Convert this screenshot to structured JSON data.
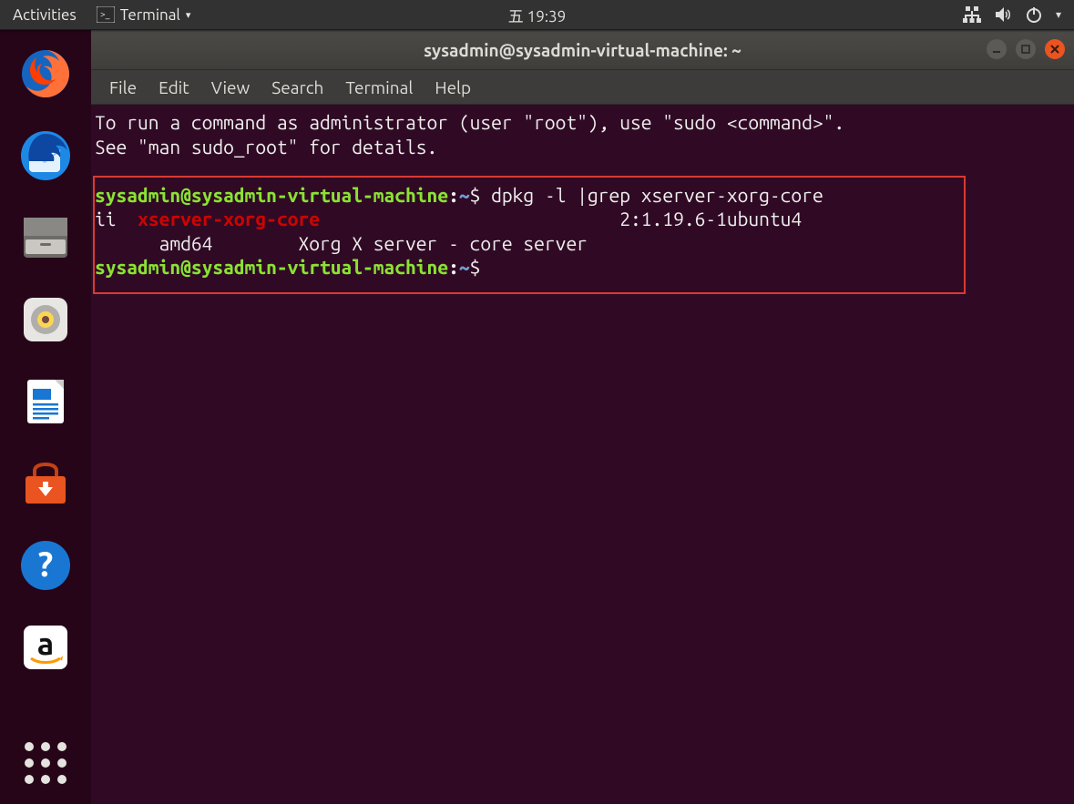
{
  "topbar": {
    "activities": "Activities",
    "app_label": "Terminal",
    "clock": "五 19:39"
  },
  "dock": {
    "items": [
      "firefox",
      "thunderbird",
      "files",
      "rhythmbox",
      "writer",
      "software-center",
      "help",
      "amazon"
    ],
    "show_apps": "show-applications"
  },
  "window": {
    "title": "sysadmin@sysadmin-virtual-machine: ~",
    "menu": {
      "file": "File",
      "edit": "Edit",
      "view": "View",
      "search": "Search",
      "terminal": "Terminal",
      "help": "Help"
    }
  },
  "terminal": {
    "motd_line1": "To run a command as administrator (user \"root\"), use \"sudo <command>\".",
    "motd_line2": "See \"man sudo_root\" for details.",
    "prompt_user": "sysadmin@sysadmin-virtual-machine",
    "prompt_path": "~",
    "cmd1": "dpkg -l |grep xserver-xorg-core",
    "out_status": "ii",
    "out_pkg": "xserver-xorg-core",
    "out_version": "2:1.19.6-1ubuntu4",
    "out_arch_pad": "      amd64        Xorg X server - core server"
  }
}
